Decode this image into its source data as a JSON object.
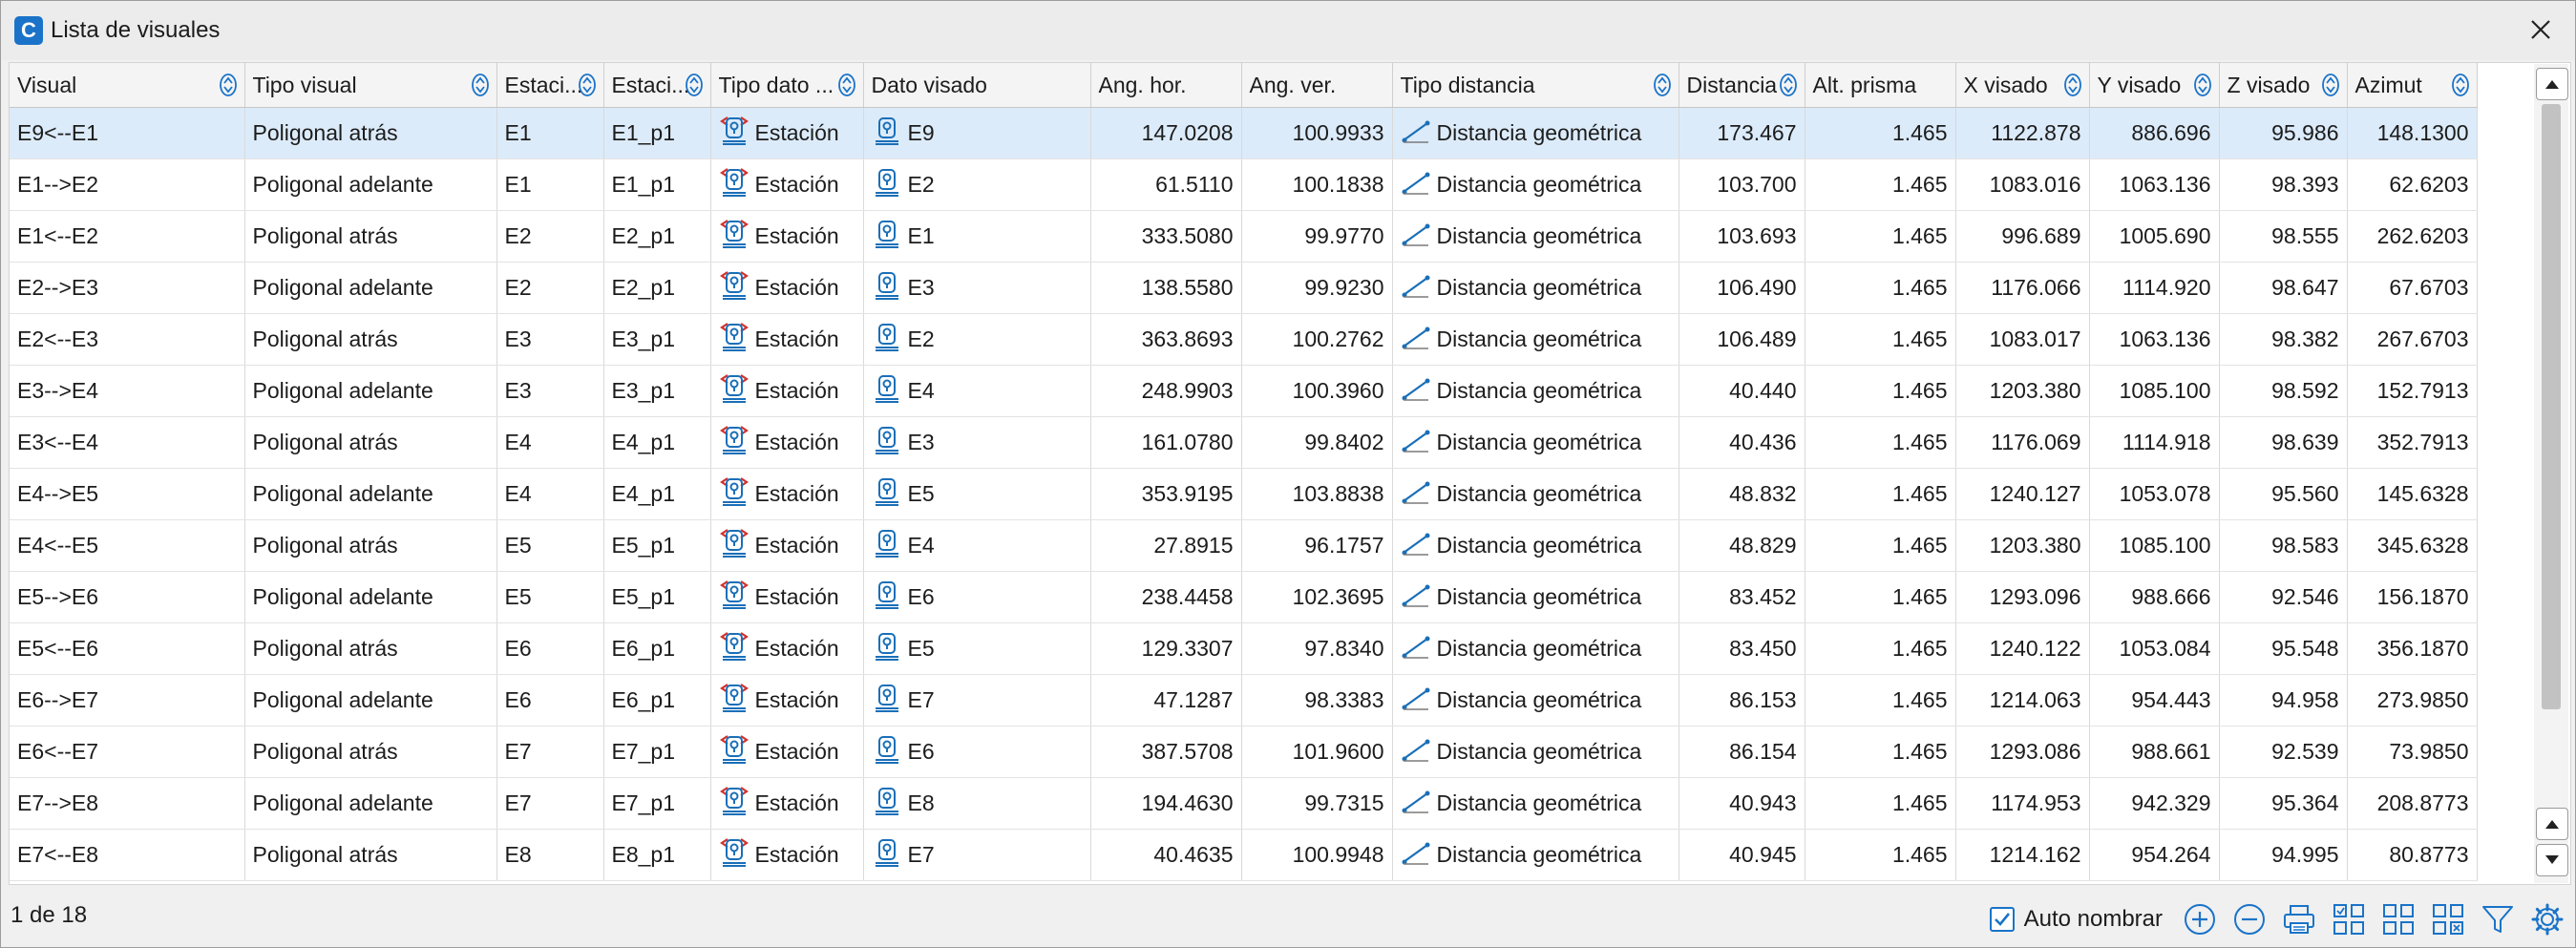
{
  "window": {
    "title": "Lista de visuales",
    "logo_letter": "C"
  },
  "columns": [
    {
      "key": "visual",
      "label": "Visual",
      "sortable": true
    },
    {
      "key": "tipo_visual",
      "label": "Tipo visual",
      "sortable": true
    },
    {
      "key": "estacion",
      "label": "Estaci...",
      "sortable": true
    },
    {
      "key": "estacion2",
      "label": "Estaci...",
      "sortable": true
    },
    {
      "key": "tipo_dato",
      "label": "Tipo dato ...",
      "sortable": true
    },
    {
      "key": "dato_visado",
      "label": "Dato visado",
      "sortable": false
    },
    {
      "key": "ang_hor",
      "label": "Ang. hor.",
      "sortable": false
    },
    {
      "key": "ang_ver",
      "label": "Ang. ver.",
      "sortable": false
    },
    {
      "key": "tipo_distancia",
      "label": "Tipo distancia",
      "sortable": true
    },
    {
      "key": "distancia",
      "label": "Distancia",
      "sortable": true
    },
    {
      "key": "alt_prisma",
      "label": "Alt. prisma",
      "sortable": false
    },
    {
      "key": "x_visado",
      "label": "X visado",
      "sortable": true
    },
    {
      "key": "y_visado",
      "label": "Y visado",
      "sortable": true
    },
    {
      "key": "z_visado",
      "label": "Z visado",
      "sortable": true
    },
    {
      "key": "azimut",
      "label": "Azimut",
      "sortable": true
    }
  ],
  "rows": [
    [
      "E9<--E1",
      "Poligonal atrás",
      "E1",
      "E1_p1",
      "Estación",
      "E9",
      "147.0208",
      "100.9933",
      "Distancia geométrica",
      "173.467",
      "1.465",
      "1122.878",
      "886.696",
      "95.986",
      "148.1300"
    ],
    [
      "E1-->E2",
      "Poligonal adelante",
      "E1",
      "E1_p1",
      "Estación",
      "E2",
      "61.5110",
      "100.1838",
      "Distancia geométrica",
      "103.700",
      "1.465",
      "1083.016",
      "1063.136",
      "98.393",
      "62.6203"
    ],
    [
      "E1<--E2",
      "Poligonal atrás",
      "E2",
      "E2_p1",
      "Estación",
      "E1",
      "333.5080",
      "99.9770",
      "Distancia geométrica",
      "103.693",
      "1.465",
      "996.689",
      "1005.690",
      "98.555",
      "262.6203"
    ],
    [
      "E2-->E3",
      "Poligonal adelante",
      "E2",
      "E2_p1",
      "Estación",
      "E3",
      "138.5580",
      "99.9230",
      "Distancia geométrica",
      "106.490",
      "1.465",
      "1176.066",
      "1114.920",
      "98.647",
      "67.6703"
    ],
    [
      "E2<--E3",
      "Poligonal atrás",
      "E3",
      "E3_p1",
      "Estación",
      "E2",
      "363.8693",
      "100.2762",
      "Distancia geométrica",
      "106.489",
      "1.465",
      "1083.017",
      "1063.136",
      "98.382",
      "267.6703"
    ],
    [
      "E3-->E4",
      "Poligonal adelante",
      "E3",
      "E3_p1",
      "Estación",
      "E4",
      "248.9903",
      "100.3960",
      "Distancia geométrica",
      "40.440",
      "1.465",
      "1203.380",
      "1085.100",
      "98.592",
      "152.7913"
    ],
    [
      "E3<--E4",
      "Poligonal atrás",
      "E4",
      "E4_p1",
      "Estación",
      "E3",
      "161.0780",
      "99.8402",
      "Distancia geométrica",
      "40.436",
      "1.465",
      "1176.069",
      "1114.918",
      "98.639",
      "352.7913"
    ],
    [
      "E4-->E5",
      "Poligonal adelante",
      "E4",
      "E4_p1",
      "Estación",
      "E5",
      "353.9195",
      "103.8838",
      "Distancia geométrica",
      "48.832",
      "1.465",
      "1240.127",
      "1053.078",
      "95.560",
      "145.6328"
    ],
    [
      "E4<--E5",
      "Poligonal atrás",
      "E5",
      "E5_p1",
      "Estación",
      "E4",
      "27.8915",
      "96.1757",
      "Distancia geométrica",
      "48.829",
      "1.465",
      "1203.380",
      "1085.100",
      "98.583",
      "345.6328"
    ],
    [
      "E5-->E6",
      "Poligonal adelante",
      "E5",
      "E5_p1",
      "Estación",
      "E6",
      "238.4458",
      "102.3695",
      "Distancia geométrica",
      "83.452",
      "1.465",
      "1293.096",
      "988.666",
      "92.546",
      "156.1870"
    ],
    [
      "E5<--E6",
      "Poligonal atrás",
      "E6",
      "E6_p1",
      "Estación",
      "E5",
      "129.3307",
      "97.8340",
      "Distancia geométrica",
      "83.450",
      "1.465",
      "1240.122",
      "1053.084",
      "95.548",
      "356.1870"
    ],
    [
      "E6-->E7",
      "Poligonal adelante",
      "E6",
      "E6_p1",
      "Estación",
      "E7",
      "47.1287",
      "98.3383",
      "Distancia geométrica",
      "86.153",
      "1.465",
      "1214.063",
      "954.443",
      "94.958",
      "273.9850"
    ],
    [
      "E6<--E7",
      "Poligonal atrás",
      "E7",
      "E7_p1",
      "Estación",
      "E6",
      "387.5708",
      "101.9600",
      "Distancia geométrica",
      "86.154",
      "1.465",
      "1293.086",
      "988.661",
      "92.539",
      "73.9850"
    ],
    [
      "E7-->E8",
      "Poligonal adelante",
      "E7",
      "E7_p1",
      "Estación",
      "E8",
      "194.4630",
      "99.7315",
      "Distancia geométrica",
      "40.943",
      "1.465",
      "1174.953",
      "942.329",
      "95.364",
      "208.8773"
    ],
    [
      "E7<--E8",
      "Poligonal atrás",
      "E8",
      "E8_p1",
      "Estación",
      "E7",
      "40.4635",
      "100.9948",
      "Distancia geométrica",
      "40.945",
      "1.465",
      "1214.162",
      "954.264",
      "94.995",
      "80.8773"
    ]
  ],
  "selected_row": 0,
  "status": {
    "page_info": "1 de 18",
    "auto_name_label": "Auto nombrar",
    "auto_name_checked": true
  },
  "colors": {
    "accent": "#1a73c8",
    "station_icon": "#1a6fb8",
    "station_arrow": "#d0322d",
    "selected_row": "#dcebfa"
  },
  "toolbar_icons": [
    "add-icon",
    "remove-icon",
    "print-icon",
    "grid-view-1-icon",
    "grid-view-2-icon",
    "grid-view-3-icon",
    "filter-icon",
    "settings-icon"
  ]
}
